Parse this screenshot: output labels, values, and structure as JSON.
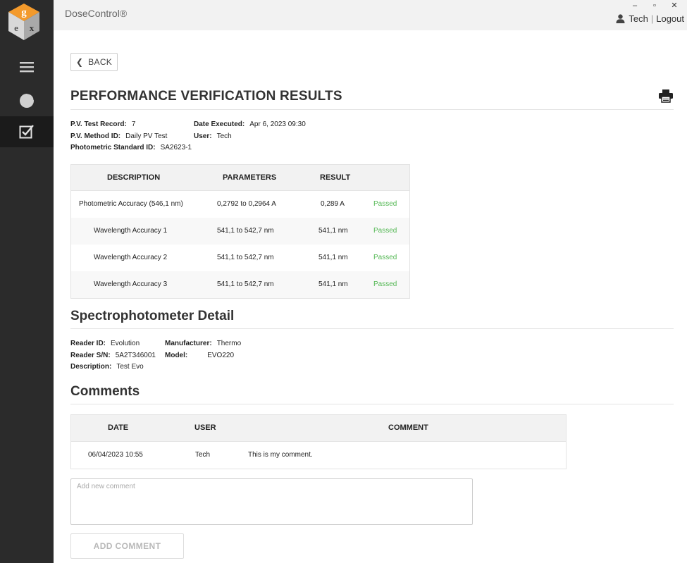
{
  "app": {
    "title": "DoseControl®",
    "logo_letters": [
      "g",
      "e",
      "x"
    ]
  },
  "window_controls": {
    "minimize": "–",
    "maximize": "▫",
    "close": "✕"
  },
  "user": {
    "name": "Tech",
    "separator": "|",
    "logout_label": "Logout"
  },
  "sidebar": {
    "items": [
      {
        "icon": "menu-icon",
        "active": false
      },
      {
        "icon": "pie-chart-icon",
        "active": false
      },
      {
        "icon": "checkbox-icon",
        "active": true
      }
    ]
  },
  "back_label": "BACK",
  "page_title": "PERFORMANCE VERIFICATION RESULTS",
  "pv_info": {
    "test_record_label": "P.V. Test Record:",
    "test_record_value": "7",
    "method_id_label": "P.V. Method ID:",
    "method_id_value": "Daily PV Test",
    "standard_id_label": "Photometric Standard ID:",
    "standard_id_value": "SA2623-1",
    "date_executed_label": "Date Executed:",
    "date_executed_value": "Apr 6, 2023 09:30",
    "user_label": "User:",
    "user_value": "Tech"
  },
  "results_table": {
    "headers": {
      "description": "DESCRIPTION",
      "parameters": "PARAMETERS",
      "result": "RESULT"
    },
    "rows": [
      {
        "description": "Photometric Accuracy (546,1 nm)",
        "parameters": "0,2792 to 0,2964 A",
        "result": "0,289 A",
        "status": "Passed"
      },
      {
        "description": "Wavelength Accuracy 1",
        "parameters": "541,1 to 542,7  nm",
        "result": "541,1 nm",
        "status": "Passed"
      },
      {
        "description": "Wavelength Accuracy 2",
        "parameters": "541,1 to 542,7  nm",
        "result": "541,1 nm",
        "status": "Passed"
      },
      {
        "description": "Wavelength Accuracy 3",
        "parameters": "541,1 to 542,7  nm",
        "result": "541,1 nm",
        "status": "Passed"
      }
    ]
  },
  "spectro": {
    "title": "Spectrophotometer Detail",
    "reader_id_label": "Reader ID:",
    "reader_id_value": "Evolution",
    "reader_sn_label": "Reader S/N:",
    "reader_sn_value": "5A2T346001",
    "description_label": "Description:",
    "description_value": "Test Evo",
    "manufacturer_label": "Manufacturer:",
    "manufacturer_value": "Thermo",
    "model_label": "Model:",
    "model_value": "EVO220"
  },
  "comments": {
    "title": "Comments",
    "headers": {
      "date": "DATE",
      "user": "USER",
      "comment": "COMMENT"
    },
    "rows": [
      {
        "date": "06/04/2023 10:55",
        "user": "Tech",
        "comment": "This is my comment."
      }
    ],
    "input_placeholder": "Add new comment",
    "add_label": "ADD COMMENT"
  },
  "colors": {
    "passed": "#55b855",
    "sidebar": "#2b2b2b",
    "active_nav": "#1b1b1b"
  }
}
